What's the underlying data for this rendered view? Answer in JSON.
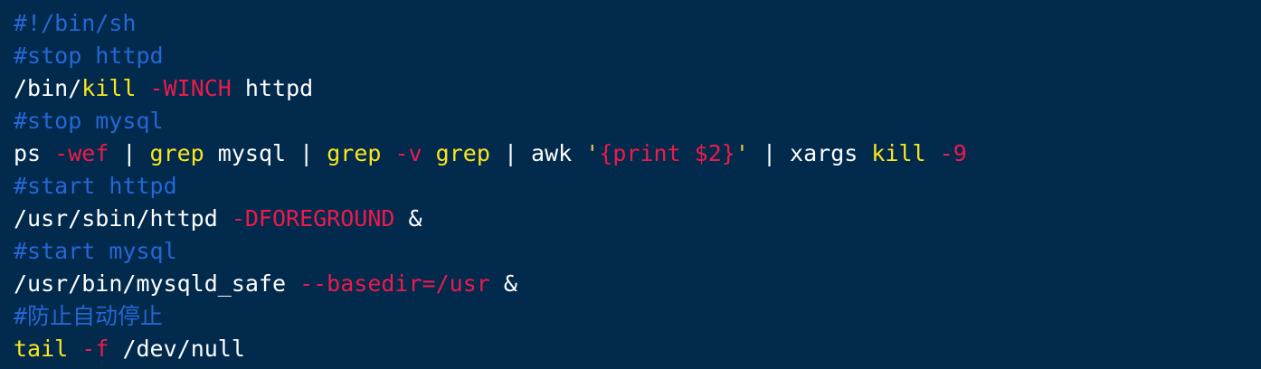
{
  "colors": {
    "background": "#012a4d",
    "comment": "#2667d6",
    "keyword": "#fbe51d",
    "option": "#ee1a4b",
    "plain": "#ffffff"
  },
  "lines": [
    [
      {
        "t": "#!/bin/sh",
        "c": "comment"
      }
    ],
    [
      {
        "t": "#stop httpd",
        "c": "comment"
      }
    ],
    [
      {
        "t": "/bin/",
        "c": "plain"
      },
      {
        "t": "kill",
        "c": "kw"
      },
      {
        "t": " ",
        "c": "plain"
      },
      {
        "t": "-WINCH",
        "c": "opt"
      },
      {
        "t": " httpd",
        "c": "plain"
      }
    ],
    [
      {
        "t": "#stop mysql",
        "c": "comment"
      }
    ],
    [
      {
        "t": "ps ",
        "c": "plain"
      },
      {
        "t": "-wef",
        "c": "opt"
      },
      {
        "t": " | ",
        "c": "plain"
      },
      {
        "t": "grep",
        "c": "kw"
      },
      {
        "t": " mysql | ",
        "c": "plain"
      },
      {
        "t": "grep",
        "c": "kw"
      },
      {
        "t": " ",
        "c": "plain"
      },
      {
        "t": "-v",
        "c": "opt"
      },
      {
        "t": " ",
        "c": "plain"
      },
      {
        "t": "grep",
        "c": "kw"
      },
      {
        "t": " | awk ",
        "c": "plain"
      },
      {
        "t": "'",
        "c": "strq"
      },
      {
        "t": "{print $2}",
        "c": "str"
      },
      {
        "t": "'",
        "c": "strq"
      },
      {
        "t": " | xargs ",
        "c": "plain"
      },
      {
        "t": "kill",
        "c": "kw"
      },
      {
        "t": " ",
        "c": "plain"
      },
      {
        "t": "-9",
        "c": "opt"
      }
    ],
    [
      {
        "t": "#start httpd",
        "c": "comment"
      }
    ],
    [
      {
        "t": "/usr/sbin/httpd ",
        "c": "plain"
      },
      {
        "t": "-DFOREGROUND",
        "c": "opt"
      },
      {
        "t": " &",
        "c": "plain"
      }
    ],
    [
      {
        "t": "#start mysql",
        "c": "comment"
      }
    ],
    [
      {
        "t": "/usr/bin/mysqld_safe ",
        "c": "plain"
      },
      {
        "t": "--basedir=/usr",
        "c": "opt"
      },
      {
        "t": " &",
        "c": "plain"
      }
    ],
    [
      {
        "t": "#防止自动停止",
        "c": "comment"
      }
    ],
    [
      {
        "t": "tail",
        "c": "kw"
      },
      {
        "t": " ",
        "c": "plain"
      },
      {
        "t": "-f",
        "c": "opt"
      },
      {
        "t": " /dev/null",
        "c": "plain"
      }
    ]
  ]
}
